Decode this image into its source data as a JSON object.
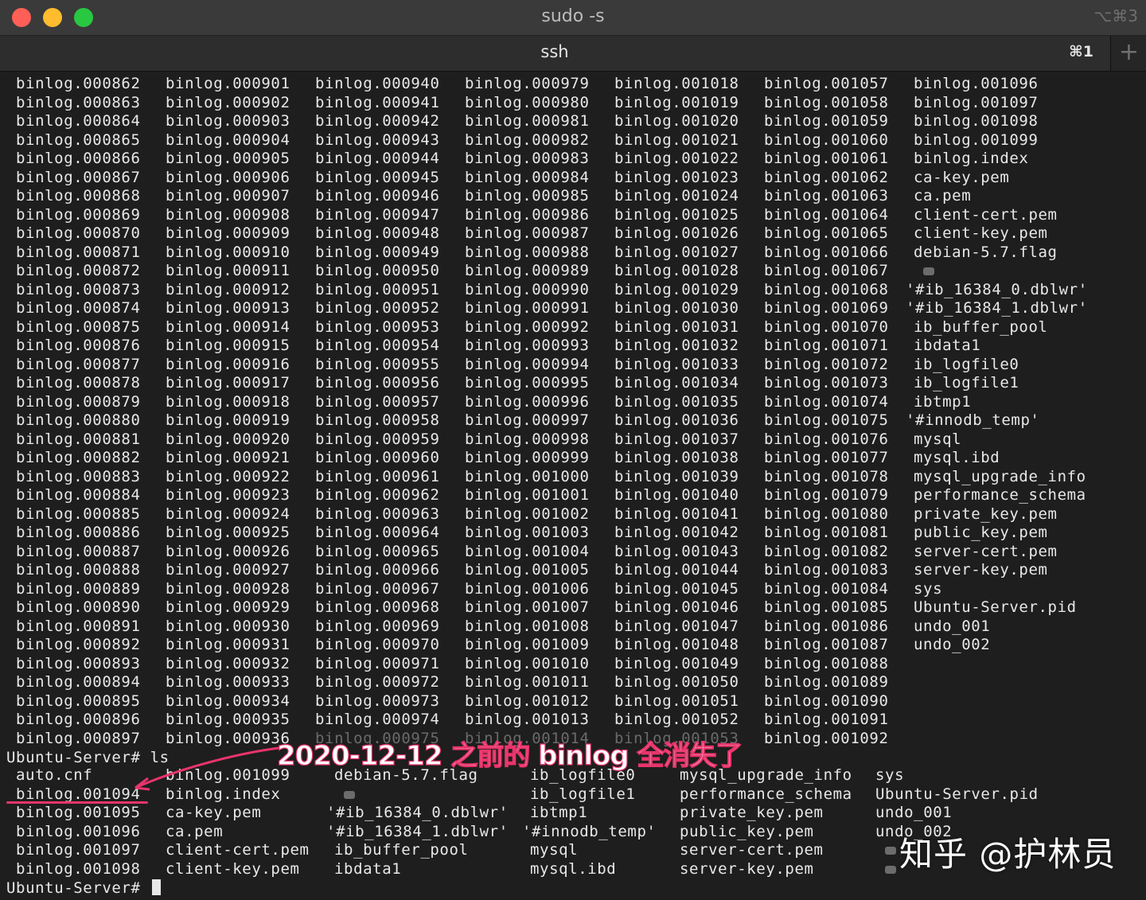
{
  "window": {
    "title": "sudo -s",
    "shortcut": "⌥⌘3",
    "tab_label": "ssh",
    "tab_shortcut": "⌘1",
    "new_tab_icon": "+"
  },
  "listing_before": [
    [
      "binlog.000862",
      "binlog.000863",
      "binlog.000864",
      "binlog.000865",
      "binlog.000866",
      "binlog.000867",
      "binlog.000868",
      "binlog.000869",
      "binlog.000870",
      "binlog.000871",
      "binlog.000872",
      "binlog.000873",
      "binlog.000874",
      "binlog.000875",
      "binlog.000876",
      "binlog.000877",
      "binlog.000878",
      "binlog.000879",
      "binlog.000880",
      "binlog.000881",
      "binlog.000882",
      "binlog.000883",
      "binlog.000884",
      "binlog.000885",
      "binlog.000886",
      "binlog.000887",
      "binlog.000888",
      "binlog.000889",
      "binlog.000890",
      "binlog.000891",
      "binlog.000892",
      "binlog.000893",
      "binlog.000894",
      "binlog.000895",
      "binlog.000896",
      "binlog.000897"
    ],
    [
      "binlog.000901",
      "binlog.000902",
      "binlog.000903",
      "binlog.000904",
      "binlog.000905",
      "binlog.000906",
      "binlog.000907",
      "binlog.000908",
      "binlog.000909",
      "binlog.000910",
      "binlog.000911",
      "binlog.000912",
      "binlog.000913",
      "binlog.000914",
      "binlog.000915",
      "binlog.000916",
      "binlog.000917",
      "binlog.000918",
      "binlog.000919",
      "binlog.000920",
      "binlog.000921",
      "binlog.000922",
      "binlog.000923",
      "binlog.000924",
      "binlog.000925",
      "binlog.000926",
      "binlog.000927",
      "binlog.000928",
      "binlog.000929",
      "binlog.000930",
      "binlog.000931",
      "binlog.000932",
      "binlog.000933",
      "binlog.000934",
      "binlog.000935",
      "binlog.000936"
    ],
    [
      "binlog.000940",
      "binlog.000941",
      "binlog.000942",
      "binlog.000943",
      "binlog.000944",
      "binlog.000945",
      "binlog.000946",
      "binlog.000947",
      "binlog.000948",
      "binlog.000949",
      "binlog.000950",
      "binlog.000951",
      "binlog.000952",
      "binlog.000953",
      "binlog.000954",
      "binlog.000955",
      "binlog.000956",
      "binlog.000957",
      "binlog.000958",
      "binlog.000959",
      "binlog.000960",
      "binlog.000961",
      "binlog.000962",
      "binlog.000963",
      "binlog.000964",
      "binlog.000965",
      "binlog.000966",
      "binlog.000967",
      "binlog.000968",
      "binlog.000969",
      "binlog.000970",
      "binlog.000971",
      "binlog.000972",
      "binlog.000973",
      "binlog.000974",
      "binlog.000975"
    ],
    [
      "binlog.000979",
      "binlog.000980",
      "binlog.000981",
      "binlog.000982",
      "binlog.000983",
      "binlog.000984",
      "binlog.000985",
      "binlog.000986",
      "binlog.000987",
      "binlog.000988",
      "binlog.000989",
      "binlog.000990",
      "binlog.000991",
      "binlog.000992",
      "binlog.000993",
      "binlog.000994",
      "binlog.000995",
      "binlog.000996",
      "binlog.000997",
      "binlog.000998",
      "binlog.000999",
      "binlog.001000",
      "binlog.001001",
      "binlog.001002",
      "binlog.001003",
      "binlog.001004",
      "binlog.001005",
      "binlog.001006",
      "binlog.001007",
      "binlog.001008",
      "binlog.001009",
      "binlog.001010",
      "binlog.001011",
      "binlog.001012",
      "binlog.001013",
      "binlog.001014"
    ],
    [
      "binlog.001018",
      "binlog.001019",
      "binlog.001020",
      "binlog.001021",
      "binlog.001022",
      "binlog.001023",
      "binlog.001024",
      "binlog.001025",
      "binlog.001026",
      "binlog.001027",
      "binlog.001028",
      "binlog.001029",
      "binlog.001030",
      "binlog.001031",
      "binlog.001032",
      "binlog.001033",
      "binlog.001034",
      "binlog.001035",
      "binlog.001036",
      "binlog.001037",
      "binlog.001038",
      "binlog.001039",
      "binlog.001040",
      "binlog.001041",
      "binlog.001042",
      "binlog.001043",
      "binlog.001044",
      "binlog.001045",
      "binlog.001046",
      "binlog.001047",
      "binlog.001048",
      "binlog.001049",
      "binlog.001050",
      "binlog.001051",
      "binlog.001052",
      "binlog.001053"
    ],
    [
      "binlog.001057",
      "binlog.001058",
      "binlog.001059",
      "binlog.001060",
      "binlog.001061",
      "binlog.001062",
      "binlog.001063",
      "binlog.001064",
      "binlog.001065",
      "binlog.001066",
      "binlog.001067",
      "binlog.001068",
      "binlog.001069",
      "binlog.001070",
      "binlog.001071",
      "binlog.001072",
      "binlog.001073",
      "binlog.001074",
      "binlog.001075",
      "binlog.001076",
      "binlog.001077",
      "binlog.001078",
      "binlog.001079",
      "binlog.001080",
      "binlog.001081",
      "binlog.001082",
      "binlog.001083",
      "binlog.001084",
      "binlog.001085",
      "binlog.001086",
      "binlog.001087",
      "binlog.001088",
      "binlog.001089",
      "binlog.001090",
      "binlog.001091",
      "binlog.001092"
    ],
    [
      "binlog.001096",
      "binlog.001097",
      "binlog.001098",
      "binlog.001099",
      "binlog.index",
      "ca-key.pem",
      "ca.pem",
      "client-cert.pem",
      "client-key.pem",
      "debian-5.7.flag",
      "",
      "'#ib_16384_0.dblwr'",
      "'#ib_16384_1.dblwr'",
      "ib_buffer_pool",
      "ibdata1",
      "ib_logfile0",
      "ib_logfile1",
      "ibtmp1",
      "'#innodb_temp'",
      "mysql",
      "mysql.ibd",
      "mysql_upgrade_info",
      "performance_schema",
      "private_key.pem",
      "public_key.pem",
      "server-cert.pem",
      "server-key.pem",
      "sys",
      "Ubuntu-Server.pid",
      "undo_001",
      "undo_002"
    ]
  ],
  "prompt_ls": "Ubuntu-Server# ls",
  "listing_after": [
    [
      "auto.cnf",
      "binlog.001094",
      "binlog.001095",
      "binlog.001096",
      "binlog.001097",
      "binlog.001098"
    ],
    [
      "binlog.001099",
      "binlog.index",
      "ca-key.pem",
      "ca.pem",
      "client-cert.pem",
      "client-key.pem"
    ],
    [
      "debian-5.7.flag",
      "",
      "'#ib_16384_0.dblwr'",
      "'#ib_16384_1.dblwr'",
      "ib_buffer_pool",
      "ibdata1"
    ],
    [
      "ib_logfile0",
      "ib_logfile1",
      "ibtmp1",
      "'#innodb_temp'",
      "mysql",
      "mysql.ibd"
    ],
    [
      "mysql_upgrade_info",
      "performance_schema",
      "private_key.pem",
      "public_key.pem",
      "server-cert.pem",
      "server-key.pem"
    ],
    [
      "sys",
      "Ubuntu-Server.pid",
      "undo_001",
      "undo_002",
      "",
      ""
    ]
  ],
  "prompt_final": "Ubuntu-Server# ",
  "annotation": "2020-12-12 之前的 binlog 全消失了",
  "watermark": "知乎 @护林员",
  "colors": {
    "terminal_bg": "#1e1e1e",
    "text": "#e8e8e8",
    "annotation": "#e8346b"
  }
}
